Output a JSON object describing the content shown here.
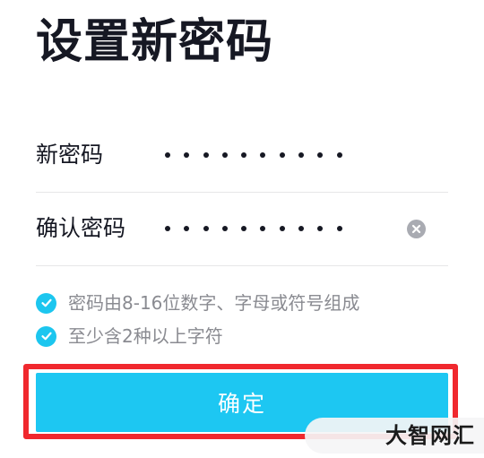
{
  "page": {
    "title": "设置新密码"
  },
  "form": {
    "new_password": {
      "label": "新密码",
      "masked_length": 10
    },
    "confirm_password": {
      "label": "确认密码",
      "masked_length": 10,
      "clear_icon": "clear-circle-x-icon"
    }
  },
  "rules": [
    {
      "text": "密码由8-16位数字、字母或符号组成",
      "icon": "check-circle-icon",
      "satisfied": true
    },
    {
      "text": "至少含2种以上字符",
      "icon": "check-circle-icon",
      "satisfied": true
    }
  ],
  "actions": {
    "confirm_label": "确定"
  },
  "watermark": {
    "text": "大智网汇"
  },
  "colors": {
    "title_text": "#161823",
    "accent": "#1dc7f2",
    "hint_text": "#8a8b91",
    "highlight_border": "#f0282e",
    "clear_icon_bg": "#a9abb2",
    "divider": "#e6e6e8"
  }
}
